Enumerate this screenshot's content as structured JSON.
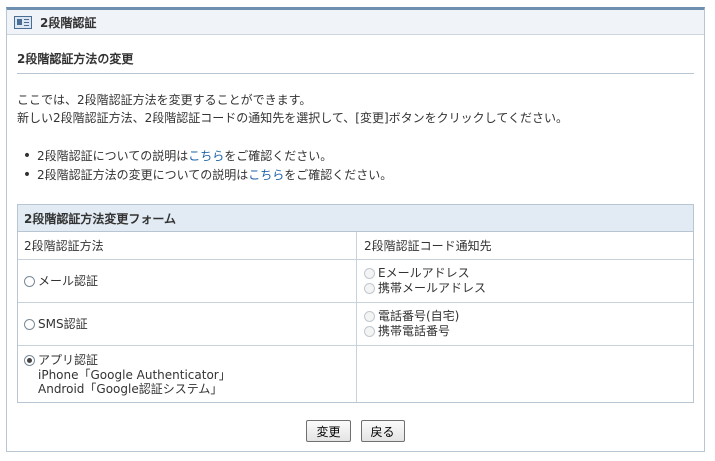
{
  "panel": {
    "title": "2段階認証"
  },
  "section_title": "2段階認証方法の変更",
  "description": {
    "line1": "ここでは、2段階認証方法を変更することができます。",
    "line2": "新しい2段階認証方法、2段階認証コードの通知先を選択して、[変更]ボタンをクリックしてください。"
  },
  "bullets": [
    {
      "before": "2段階認証についての説明は ",
      "link": "こちら",
      "after": "をご確認ください。"
    },
    {
      "before": "2段階認証方法の変更についての説明は ",
      "link": "こちら",
      "after": "をご確認ください。"
    }
  ],
  "form": {
    "caption": "2段階認証方法変更フォーム",
    "col_method": "2段階認証方法",
    "col_notify": "2段階認証コード通知先",
    "options": [
      {
        "label": "メール認証",
        "selected": false,
        "notify": [
          "Eメールアドレス",
          "携帯メールアドレス"
        ]
      },
      {
        "label": "SMS認証",
        "selected": false,
        "notify": [
          "電話番号(自宅)",
          "携帯電話番号"
        ]
      },
      {
        "label": "アプリ認証",
        "selected": true,
        "sub": [
          "iPhone「Google Authenticator」",
          "Android「Google認証システム」"
        ],
        "notify": []
      }
    ]
  },
  "buttons": {
    "change": "変更",
    "back": "戻る"
  }
}
